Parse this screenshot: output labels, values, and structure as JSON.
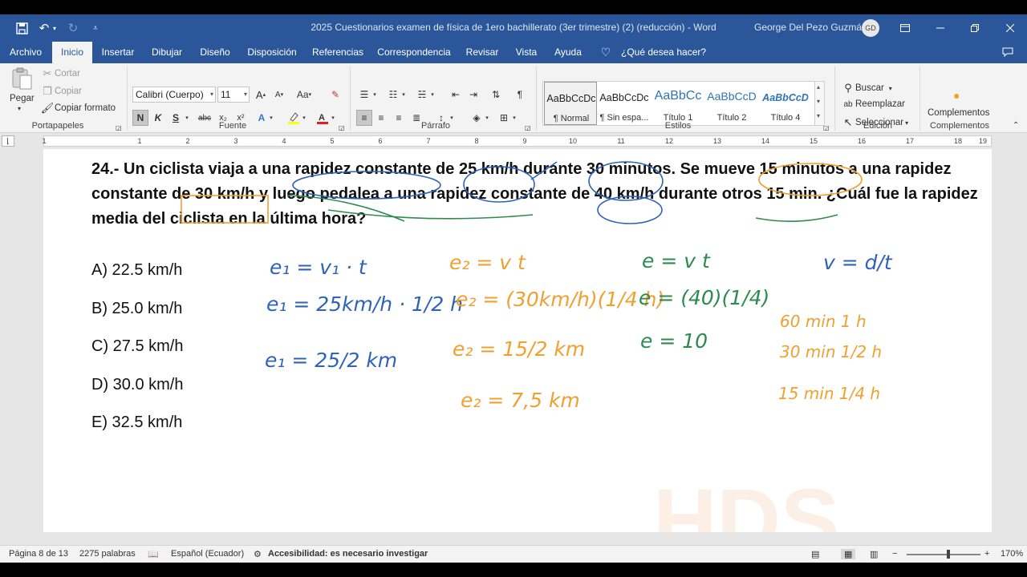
{
  "titlebar": {
    "document_title": "2025 Cuestionarios examen de física de 1ero bachillerato (3er trimestre) (2) (reducción)  -  Word",
    "user_name": "George Del Pezo Guzmán",
    "user_initials": "GD"
  },
  "tabs": [
    {
      "label": "Archivo"
    },
    {
      "label": "Inicio"
    },
    {
      "label": "Insertar"
    },
    {
      "label": "Dibujar"
    },
    {
      "label": "Diseño"
    },
    {
      "label": "Disposición"
    },
    {
      "label": "Referencias"
    },
    {
      "label": "Correspondencia"
    },
    {
      "label": "Revisar"
    },
    {
      "label": "Vista"
    },
    {
      "label": "Ayuda"
    }
  ],
  "tell_me": "¿Qué desea hacer?",
  "clipboard": {
    "paste": "Pegar",
    "cut": "Cortar",
    "copy": "Copiar",
    "format_painter": "Copiar formato",
    "label": "Portapapeles"
  },
  "font": {
    "family": "Calibri (Cuerpo)",
    "size": "11",
    "label": "Fuente",
    "bold": "N",
    "italic": "K",
    "underline": "S",
    "strike": "abc",
    "subscript": "x₂",
    "superscript": "x²",
    "grow": "A",
    "shrink": "A",
    "case": "Aa"
  },
  "paragraph": {
    "label": "Párrafo"
  },
  "styles": {
    "label": "Estilos",
    "items": [
      {
        "sample": "AaBbCcDc",
        "name": "¶ Normal"
      },
      {
        "sample": "AaBbCcDc",
        "name": "¶ Sin espa..."
      },
      {
        "sample": "AaBbCc",
        "name": "Título 1"
      },
      {
        "sample": "AaBbCcD",
        "name": "Título 2"
      },
      {
        "sample": "AaBbCcD",
        "name": "Título 4"
      }
    ]
  },
  "editing": {
    "find": "Buscar",
    "replace": "Reemplazar",
    "select": "Seleccionar",
    "label": "Edición"
  },
  "addins": {
    "button": "Complementos",
    "label": "Complementos"
  },
  "ruler": {
    "marks": [
      "1",
      "1",
      "2",
      "3",
      "4",
      "5",
      "6",
      "7",
      "8",
      "9",
      "10",
      "11",
      "12",
      "13",
      "14",
      "15",
      "16",
      "17",
      "18",
      "19"
    ]
  },
  "document": {
    "question": "24.- Un ciclista viaja a una rapidez constante de 25 km/h durante 30 minutos. Se mueve 15 minutos a una rapidez constante de 30 km/h y luego pedalea a una rapidez constante de 40 km/h durante otros 15 min. ¿Cuál fue la rapidez media del ciclista en la última hora?",
    "options": [
      "A) 22.5 km/h",
      "B) 25.0 km/h",
      "C) 27.5 km/h",
      "D) 30.0 km/h",
      "E) 32.5 km/h"
    ]
  },
  "annotations": {
    "blue": [
      "e₁ = v₁ · t",
      "e₁ = 25km/h · 1/2 h",
      "e₁ = 25/2 km"
    ],
    "orange": [
      "e₂ = v t",
      "e₂ = (30km/h)(1/4 h)",
      "e₂ = 15/2 km",
      "e₂ = 7,5 km"
    ],
    "green": [
      "e = v t",
      "e = (40)(1/4)",
      "e = 10"
    ],
    "formula": [
      "v = d/t"
    ],
    "conversions": [
      "60 min  1 h",
      "30 min  1/2 h",
      "15 min  1/4 h"
    ],
    "colors": {
      "blue": "#2f63b8",
      "orange": "#f0a030",
      "green": "#2e8a4e"
    }
  },
  "statusbar": {
    "page": "Página 8 de 13",
    "words": "2275 palabras",
    "language": "Español (Ecuador)",
    "accessibility": "Accesibilidad: es necesario investigar",
    "zoom": "170%"
  }
}
